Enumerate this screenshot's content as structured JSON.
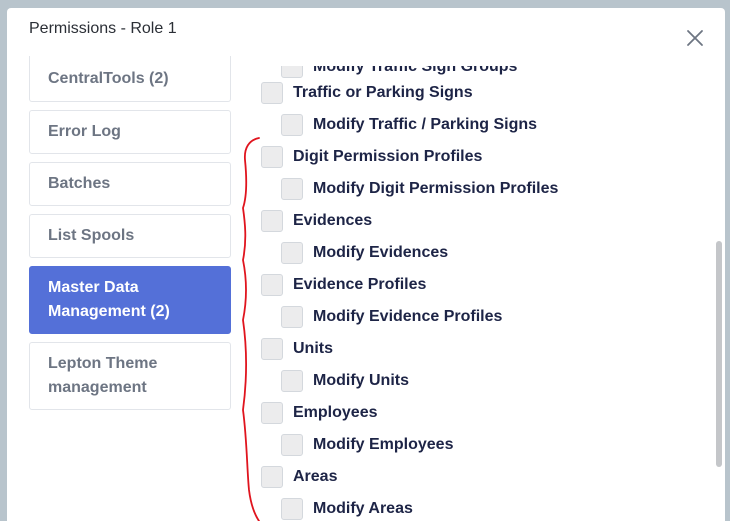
{
  "dialog": {
    "title": "Permissions - Role 1"
  },
  "sidebar": {
    "items": [
      {
        "label": "CentralTools (2)",
        "active": false
      },
      {
        "label": "Error Log",
        "active": false
      },
      {
        "label": "Batches",
        "active": false
      },
      {
        "label": "List Spools",
        "active": false
      },
      {
        "label": "Master Data Management (2)",
        "active": true
      },
      {
        "label": "Lepton Theme management",
        "active": false
      }
    ]
  },
  "permissions": {
    "items": [
      {
        "label": "Modify Traffic Sign Groups",
        "level": 1,
        "checked": false
      },
      {
        "label": "Traffic or Parking Signs",
        "level": 0,
        "checked": false
      },
      {
        "label": "Modify Traffic / Parking Signs",
        "level": 1,
        "checked": false
      },
      {
        "label": "Digit Permission Profiles",
        "level": 0,
        "checked": false
      },
      {
        "label": "Modify Digit Permission Profiles",
        "level": 1,
        "checked": false
      },
      {
        "label": "Evidences",
        "level": 0,
        "checked": false
      },
      {
        "label": "Modify Evidences",
        "level": 1,
        "checked": false
      },
      {
        "label": "Evidence Profiles",
        "level": 0,
        "checked": false
      },
      {
        "label": "Modify Evidence Profiles",
        "level": 1,
        "checked": false
      },
      {
        "label": "Units",
        "level": 0,
        "checked": false
      },
      {
        "label": "Modify Units",
        "level": 1,
        "checked": false
      },
      {
        "label": "Employees",
        "level": 0,
        "checked": false
      },
      {
        "label": "Modify Employees",
        "level": 1,
        "checked": false
      },
      {
        "label": "Areas",
        "level": 0,
        "checked": false
      },
      {
        "label": "Modify Areas",
        "level": 1,
        "checked": false
      }
    ]
  },
  "colors": {
    "accent": "#5470d8",
    "annotation": "#e0141e",
    "text": "#1d2446"
  },
  "icons": {
    "close": "close-icon"
  }
}
